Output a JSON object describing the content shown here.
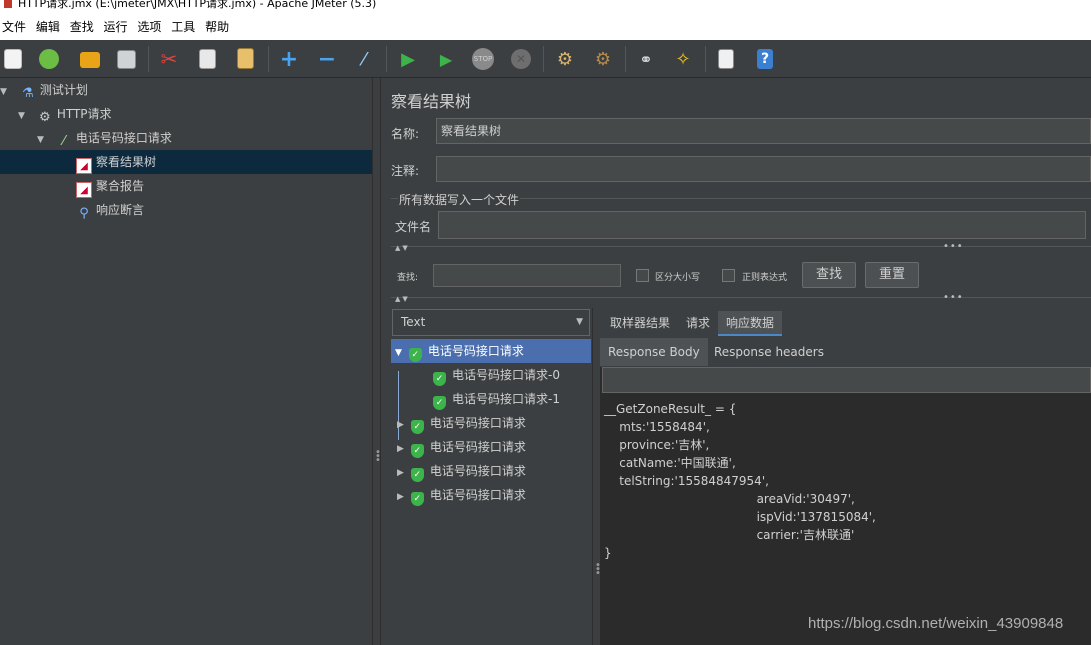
{
  "window": {
    "title": "HTTP请求.jmx (E:\\jmeter\\JMX\\HTTP请求.jmx) - Apache JMeter (5.3)"
  },
  "menu": [
    "文件",
    "编辑",
    "查找",
    "运行",
    "选项",
    "工具",
    "帮助"
  ],
  "toolbar": {
    "icons": [
      "new-icon",
      "templates-icon",
      "open-icon",
      "save-icon",
      "cut-icon",
      "copy-icon",
      "paste-icon",
      "expand-icon",
      "collapse-icon",
      "toggle-icon",
      "start-icon",
      "start-no-pause-icon",
      "stop-icon",
      "shutdown-icon",
      "clear-icon",
      "clear-all-icon",
      "search-icon",
      "reset-search-icon",
      "log-viewer-icon",
      "help-icon"
    ],
    "stop_label": "STOP"
  },
  "tree": {
    "items": [
      {
        "label": "测试计划",
        "icon": "flask-icon"
      },
      {
        "label": "HTTP请求",
        "icon": "gear-icon"
      },
      {
        "label": "电话号码接口请求",
        "icon": "pipette-icon"
      },
      {
        "label": "察看结果树",
        "icon": "chart-icon"
      },
      {
        "label": "聚合报告",
        "icon": "chart-icon"
      },
      {
        "label": "响应断言",
        "icon": "magnifier-icon"
      }
    ]
  },
  "panel": {
    "title": "察看结果树",
    "name_label": "名称:",
    "name_value": "察看结果树",
    "comment_label": "注释:",
    "comment_value": "",
    "file_group": "所有数据写入一个文件",
    "file_label": "文件名",
    "file_value": ""
  },
  "search": {
    "label": "查找:",
    "value": "",
    "case_label": "区分大小写",
    "regex_label": "正则表达式",
    "find_button": "查找",
    "reset_button": "重置"
  },
  "results": {
    "renderer": "Text",
    "samples": [
      {
        "label": "电话号码接口请求"
      },
      {
        "label": "电话号码接口请求-0"
      },
      {
        "label": "电话号码接口请求-1"
      },
      {
        "label": "电话号码接口请求"
      },
      {
        "label": "电话号码接口请求"
      },
      {
        "label": "电话号码接口请求"
      },
      {
        "label": "电话号码接口请求"
      }
    ]
  },
  "detail": {
    "tabs": [
      "取样器结果",
      "请求",
      "响应数据"
    ],
    "subtabs": [
      "Response Body",
      "Response headers"
    ],
    "body": "__GetZoneResult_ = {\n    mts:'1558484',\n    province:'吉林',\n    catName:'中国联通',\n    telString:'15584847954',\n\t\t\t\t\tareaVid:'30497',\n\t\t\t\t\tispVid:'137815084',\n\t\t\t\t\tcarrier:'吉林联通'\n}"
  },
  "watermark": "https://blog.csdn.net/weixin_43909848"
}
